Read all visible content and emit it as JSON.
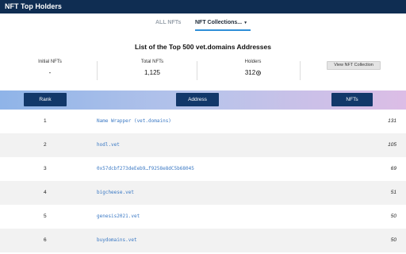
{
  "app": {
    "title": "NFT Top Holders"
  },
  "tabs": {
    "all_label": "ALL NFTs",
    "collections_label": "NFT Collections...",
    "caret": "▼"
  },
  "header": {
    "title": "List of the Top 500 vet.domains Addresses",
    "initial_nfts_label": "Initial NFTs",
    "initial_nfts_value": "-",
    "total_nfts_label": "Total NFTs",
    "total_nfts_value": "1,125",
    "holders_label": "Holders",
    "holders_value": "312",
    "owner_icon": "user-circle-icon",
    "view_collection_label": "View NFT Collection"
  },
  "columns": {
    "rank": "Rank",
    "address": "Address",
    "nfts": "NFTs"
  },
  "rows": [
    {
      "rank": "1",
      "address": "Name Wrapper (vet.domains)",
      "nfts": "131"
    },
    {
      "rank": "2",
      "address": "hodl.vet",
      "nfts": "105"
    },
    {
      "rank": "3",
      "address": "0x57dcbf273deEeb9…f9258e8dC5b68045",
      "nfts": "69"
    },
    {
      "rank": "4",
      "address": "bigcheese.vet",
      "nfts": "51"
    },
    {
      "rank": "5",
      "address": "genesis2021.vet",
      "nfts": "50"
    },
    {
      "rank": "6",
      "address": "buydomains.vet",
      "nfts": "50"
    }
  ]
}
